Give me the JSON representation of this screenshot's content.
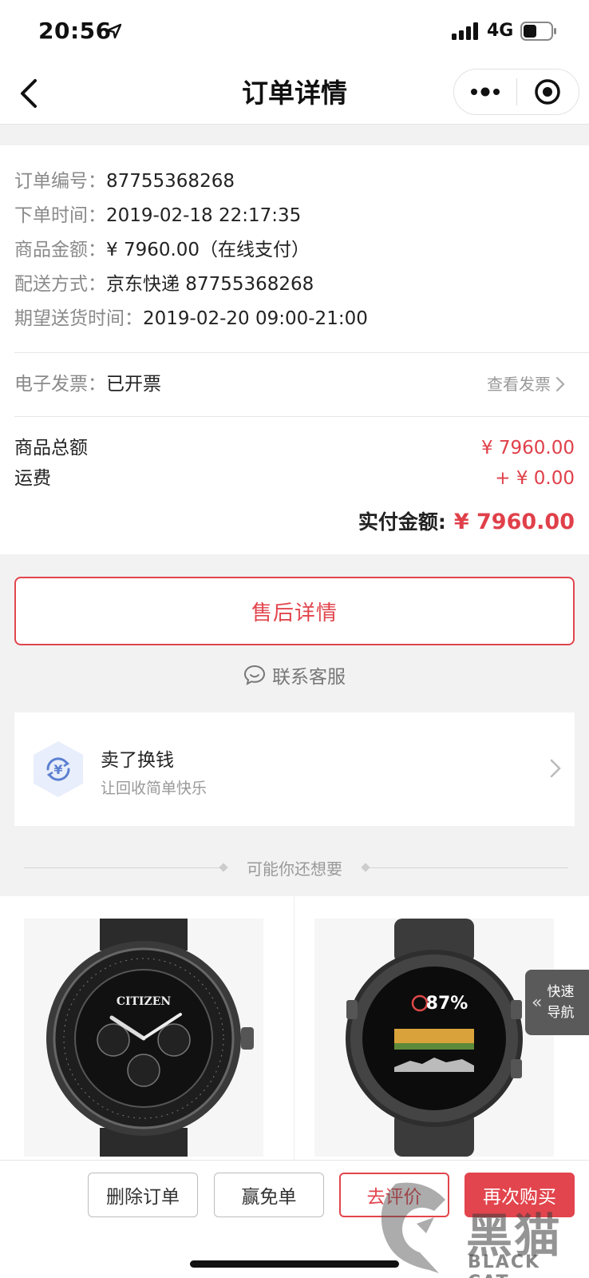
{
  "status_bar": {
    "time": "20:56",
    "network": "4G"
  },
  "nav": {
    "title": "订单详情"
  },
  "order_info": [
    {
      "key": "订单编号：",
      "value": "87755368268"
    },
    {
      "key": "下单时间：",
      "value": "2019-02-18 22:17:35"
    },
    {
      "key": "商品金额：",
      "value": "¥ 7960.00（在线支付）"
    },
    {
      "key": "配送方式：",
      "value": "京东快递 87755368268"
    },
    {
      "key": "期望送货时间：",
      "value": "2019-02-20 09:00-21:00"
    }
  ],
  "invoice": {
    "key": "电子发票：",
    "value": "已开票",
    "link": "查看发票"
  },
  "summary": {
    "goods_total_label": "商品总额",
    "goods_total_value": "¥ 7960.00",
    "shipping_label": "运费",
    "shipping_value": "+ ¥ 0.00",
    "paid_label": "实付金额:",
    "paid_value": "¥ 7960.00"
  },
  "after_sales_label": "售后详情",
  "customer_service_label": "联系客服",
  "recycle": {
    "title": "卖了换钱",
    "subtitle": "让回收简单快乐",
    "icon": "yen-recycle-icon"
  },
  "recommend_title": "可能你还想要",
  "products": [
    {
      "image": "watch-citizen",
      "brand_text": "CITIZEN"
    },
    {
      "image": "watch-garmin",
      "battery_text": "87%"
    }
  ],
  "quick_nav": {
    "line1": "快速",
    "line2": "导航"
  },
  "bottom_buttons": {
    "delete": "删除订单",
    "free": "赢免单",
    "review": "去评价",
    "rebuy": "再次购买"
  },
  "watermark": {
    "cn": "黑猫",
    "en": "BLACK CAT"
  },
  "colors": {
    "accent_red": "#e2454d",
    "price_red": "#e0404a"
  }
}
